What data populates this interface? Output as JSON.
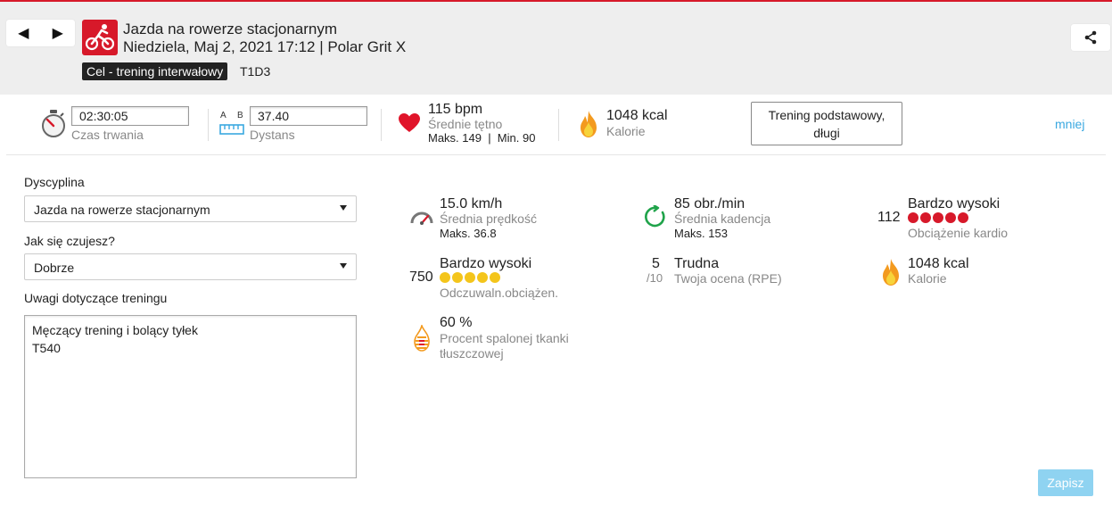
{
  "header": {
    "sport_title": "Jazda na rowerze stacjonarnym",
    "date_line": "Niedziela, Maj 2, 2021 17:12 | Polar Grit X",
    "goal_badge": "Cel - trening interwałowy",
    "goal_code": "T1D3",
    "prev_glyph": "◀",
    "next_glyph": "▶",
    "accent": "#d7192a"
  },
  "summary": {
    "duration_value": "02:30:05",
    "duration_label": "Czas trwania",
    "distance_ab_a": "A",
    "distance_ab_b": "B",
    "distance_value": "37.40",
    "distance_label": "Dystans",
    "hr_value": "115 bpm",
    "hr_label": "Średnie tętno",
    "hr_minmax": "Maks. 149  |  Min. 90",
    "calories_value": "1048 kcal",
    "calories_label": "Kalorie",
    "training_type_line1": "Trening podstawowy,",
    "training_type_line2": "długi",
    "less_link": "mniej"
  },
  "form": {
    "discipline_label": "Dyscyplina",
    "discipline_value": "Jazda na rowerze stacjonarnym",
    "feeling_label": "Jak się czujesz?",
    "feeling_value": "Dobrze",
    "notes_label": "Uwagi dotyczące treningu",
    "notes_value": "Męczący trening i bolący tyłek\nT540"
  },
  "metrics": {
    "speed_value": "15.0 km/h",
    "speed_label": "Średnia prędkość",
    "speed_max": "Maks. 36.8",
    "cadence_value": "85 obr./min",
    "cadence_label": "Średnia kadencja",
    "cadence_max": "Maks. 153",
    "cardio_number": "112",
    "cardio_value": "Bardzo wysoki",
    "cardio_label": "Obciążenie kardio",
    "cardio_dots_filled": 5,
    "perceived_number": "750",
    "perceived_value": "Bardzo wysoki",
    "perceived_label": "Odczuwaln.obciążen.",
    "perceived_dots_filled": 5,
    "rpe_number": "5",
    "rpe_denominator": "/10",
    "rpe_value": "Trudna",
    "rpe_label": "Twoja ocena (RPE)",
    "calories_value": "1048 kcal",
    "calories_label": "Kalorie",
    "fat_value": "60 %",
    "fat_label_line1": "Procent spalonej tkanki",
    "fat_label_line2": "tłuszczowej"
  },
  "actions": {
    "save_label": "Zapisz"
  },
  "colors": {
    "red_dot": "#d7192a",
    "yellow_dot": "#f4c51b",
    "link": "#3aa8e0",
    "save_bg": "#8fd3f1"
  }
}
